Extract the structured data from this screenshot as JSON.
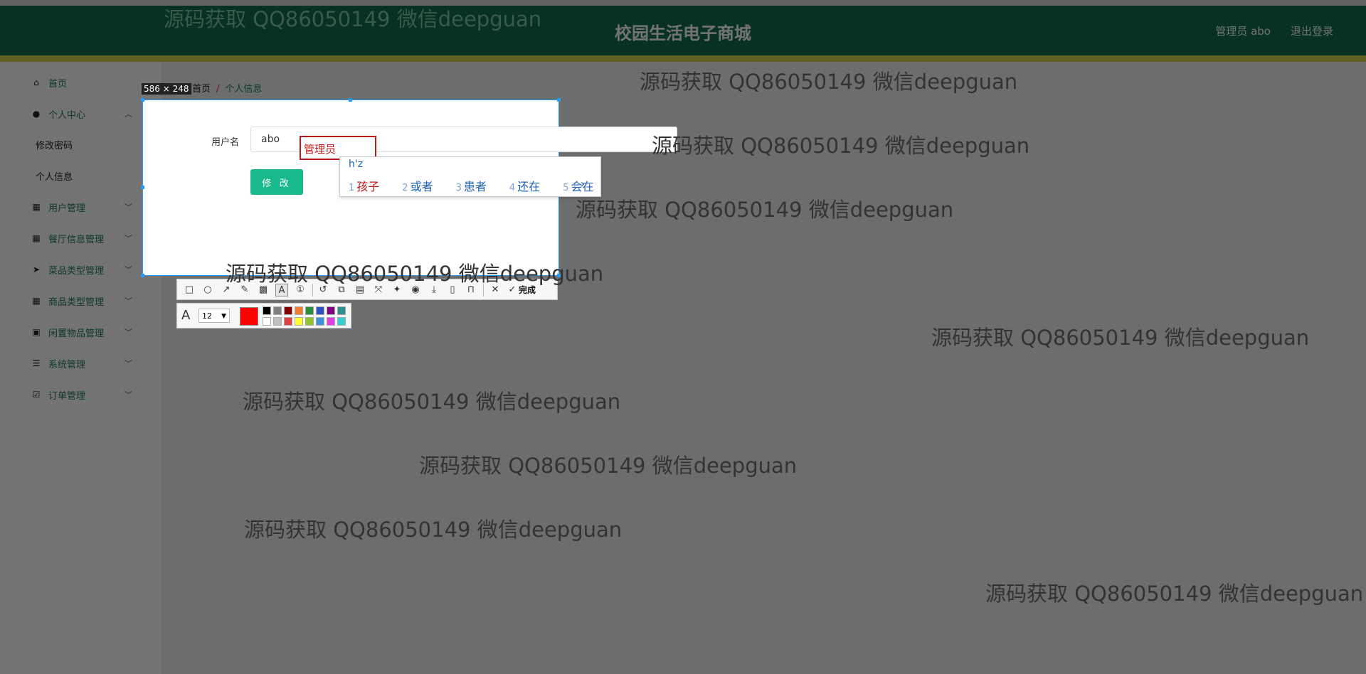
{
  "header": {
    "title": "校园生活电子商城",
    "user": "管理员 abo",
    "logout": "退出登录"
  },
  "sidebar": {
    "items": [
      {
        "label": "首页",
        "icon": "home-icon"
      },
      {
        "label": "个人中心",
        "icon": "user-icon"
      },
      {
        "label": "修改密码"
      },
      {
        "label": "个人信息"
      },
      {
        "label": "用户管理",
        "icon": "grid-icon"
      },
      {
        "label": "餐厅信息管理",
        "icon": "grid-icon"
      },
      {
        "label": "菜品类型管理",
        "icon": "send-icon"
      },
      {
        "label": "商品类型管理",
        "icon": "grid-icon"
      },
      {
        "label": "闲置物品管理",
        "icon": "clipboard-icon"
      },
      {
        "label": "系统管理",
        "icon": "sliders-icon"
      },
      {
        "label": "订单管理",
        "icon": "check-square-icon"
      }
    ]
  },
  "breadcrumb": {
    "home": "首页",
    "sep": "/",
    "current": "个人信息"
  },
  "form": {
    "username_label": "用户名",
    "username_value": "abo",
    "submit": "修 改"
  },
  "screenshot_tool": {
    "size_label": "586 × 248",
    "text_annotation": "管理员",
    "done_label": "完成",
    "font_size": "12",
    "current_color": "#ff0000",
    "palette": [
      "#000000",
      "#808080",
      "#800000",
      "#f08030",
      "#2e8b3e",
      "#3050c0",
      "#800080",
      "#2a9090",
      "#ffffff",
      "#c0c0c0",
      "#e04040",
      "#ffff30",
      "#90c030",
      "#4090e0",
      "#e040e0",
      "#30d0d0"
    ]
  },
  "ime": {
    "composition": "h'z",
    "candidates": [
      {
        "num": "1",
        "text": "孩子"
      },
      {
        "num": "2",
        "text": "或者"
      },
      {
        "num": "3",
        "text": "患者"
      },
      {
        "num": "4",
        "text": "还在"
      },
      {
        "num": "5",
        "text": "会在"
      }
    ],
    "prev": "‹",
    "next": "›"
  },
  "watermark": "源码获取 QQ86050149 微信deepguan"
}
